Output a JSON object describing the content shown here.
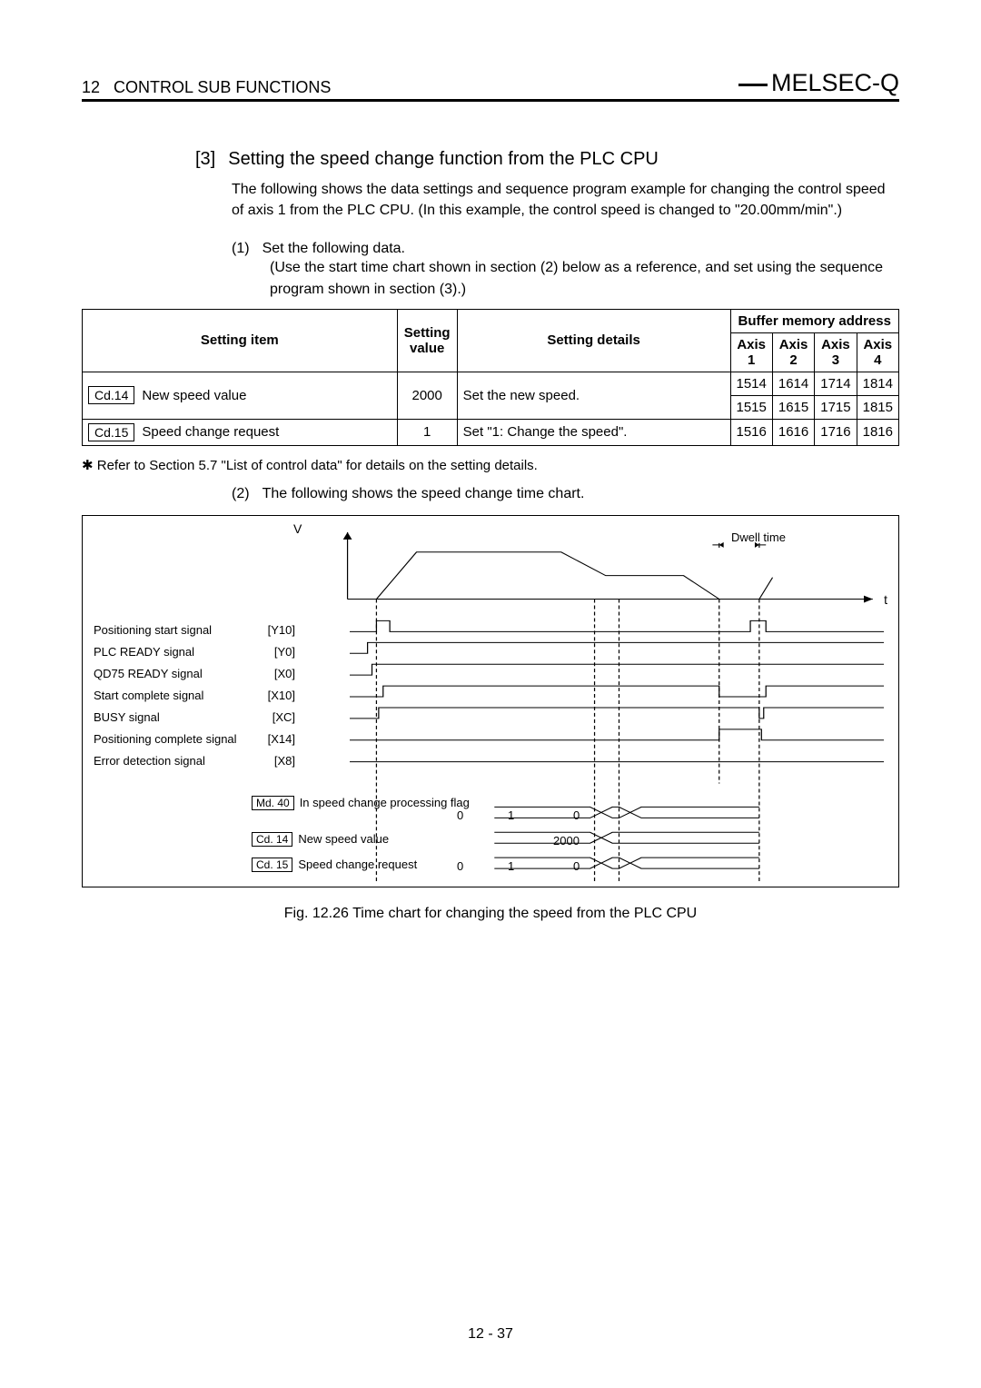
{
  "header": {
    "chapter_num": "12",
    "chapter_title": "CONTROL SUB FUNCTIONS",
    "brand": "MELSEC-Q"
  },
  "section3": {
    "num": "[3]",
    "title": "Setting the speed change function from the PLC CPU",
    "body": "The following shows the data settings and sequence program example for changing the control speed of axis 1 from the PLC CPU. (In this example, the control speed is changed to \"20.00mm/min\".)"
  },
  "sub1": {
    "num": "(1)",
    "title": "Set the following data.",
    "body": "(Use the start time chart shown in section (2) below as a reference, and set using the sequence program shown in section (3).)"
  },
  "table": {
    "headers": {
      "setting_item": "Setting item",
      "setting_value": "Setting value",
      "setting_details": "Setting details",
      "buffer_mem": "Buffer memory address",
      "axis1": "Axis 1",
      "axis2": "Axis 2",
      "axis3": "Axis 3",
      "axis4": "Axis 4"
    },
    "rows": [
      {
        "code": "Cd.14",
        "item": "New speed value",
        "value": "2000",
        "details": "Set the new speed.",
        "addr_top": [
          "1514",
          "1614",
          "1714",
          "1814"
        ],
        "addr_bot": [
          "1515",
          "1615",
          "1715",
          "1815"
        ]
      },
      {
        "code": "Cd.15",
        "item": "Speed change request",
        "value": "1",
        "details": "Set \"1: Change the speed\".",
        "addr": [
          "1516",
          "1616",
          "1716",
          "1816"
        ]
      }
    ]
  },
  "footnote": "Refer to Section 5.7 \"List of control data\" for details on the setting details.",
  "sub2": {
    "num": "(2)",
    "title": "The following shows the speed change time chart."
  },
  "figure": {
    "v": "V",
    "t": "t",
    "dwell": "Dwell time",
    "signals": [
      {
        "label": "Positioning start signal",
        "code": "[Y10]"
      },
      {
        "label": "PLC READY signal",
        "code": "[Y0]"
      },
      {
        "label": "QD75 READY signal",
        "code": "[X0]"
      },
      {
        "label": "Start complete signal",
        "code": "[X10]"
      },
      {
        "label": "BUSY signal",
        "code": "[XC]"
      },
      {
        "label": "Positioning complete signal",
        "code": "[X14]"
      },
      {
        "label": "Error detection signal",
        "code": "[X8]"
      }
    ],
    "md40": {
      "box": "Md. 40",
      "label": "In speed change processing flag"
    },
    "cd14": {
      "box": "Cd. 14",
      "label": "New speed value"
    },
    "cd15": {
      "box": "Cd. 15",
      "label": "Speed change request"
    },
    "values": {
      "zero_a1": "0",
      "one_a": "1",
      "zero_b1": "0",
      "v2000": "2000",
      "zero_a2": "0",
      "one_b": "1",
      "zero_b2": "0"
    }
  },
  "caption": "Fig. 12.26 Time chart for changing the speed from the PLC CPU",
  "page_num": "12 - 37",
  "chart_data": {
    "type": "timing",
    "title": "Time chart for changing the speed from the PLC CPU",
    "x_axis": "t",
    "y_axis_top": "V",
    "annotations": [
      "Dwell time"
    ],
    "signals": [
      {
        "name": "Positioning start signal",
        "code": "Y10",
        "trace": "low, pulse high, low (restarts near end with pulse)"
      },
      {
        "name": "PLC READY signal",
        "code": "Y0",
        "trace": "low then high and stays high"
      },
      {
        "name": "QD75 READY signal",
        "code": "X0",
        "trace": "low then high and stays high"
      },
      {
        "name": "Start complete signal",
        "code": "X10",
        "trace": "low, high during motion, low at end, repeats"
      },
      {
        "name": "BUSY signal",
        "code": "XC",
        "trace": "low, high during motion (including dwell), low, repeats"
      },
      {
        "name": "Positioning complete signal",
        "code": "X14",
        "trace": "low, pulse high at end of motion"
      },
      {
        "name": "Error detection signal",
        "code": "X8",
        "trace": "stays low"
      }
    ],
    "value_traces": [
      {
        "name": "Md.40 In speed change processing flag",
        "values": [
          "0",
          "1",
          "0"
        ]
      },
      {
        "name": "Cd.14 New speed value",
        "values": [
          "",
          "2000"
        ]
      },
      {
        "name": "Cd.15 Speed change request",
        "values": [
          "0",
          "1",
          "0"
        ]
      }
    ],
    "velocity_profile": "Trapezoid rising to set speed, mid-way speed changes (drops/rises per new value 2000), decelerates to zero, dwell, then next cycle starts"
  }
}
